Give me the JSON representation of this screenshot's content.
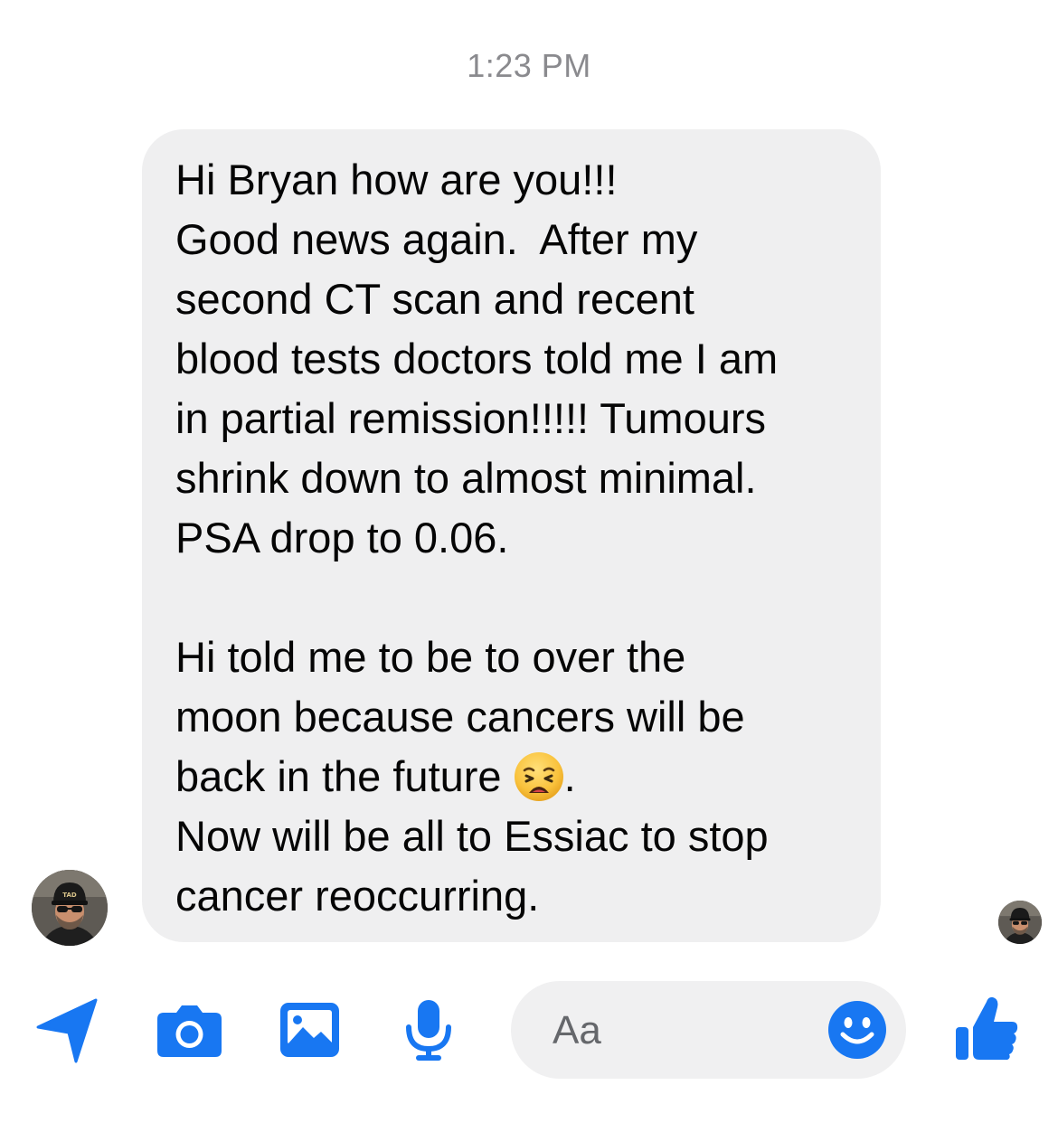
{
  "thread": {
    "timestamp": "1:23 PM"
  },
  "message": {
    "lines": [
      "Hi Bryan how are you!!!",
      "Good news again.  After my",
      "second CT scan and recent",
      "blood tests doctors told me I am",
      "in partial remission!!!!! Tumours",
      "shrink down to almost minimal.",
      "PSA drop to 0.06.",
      "Hi told me to be to over the",
      "moon because cancers will be",
      "back in the future ",
      ".",
      "Now will be all to Essiac to stop",
      "cancer reoccurring."
    ],
    "inline_emoji": "weary-face-emoji"
  },
  "avatars": {
    "sender_cap_text": "TAD"
  },
  "composer": {
    "placeholder": "Aa"
  },
  "icons": {
    "accent": "#1877f2",
    "toolbar": [
      "send-location-icon",
      "camera-icon",
      "photo-gallery-icon",
      "microphone-icon",
      "emoji-icon",
      "thumbs-up-icon"
    ]
  }
}
